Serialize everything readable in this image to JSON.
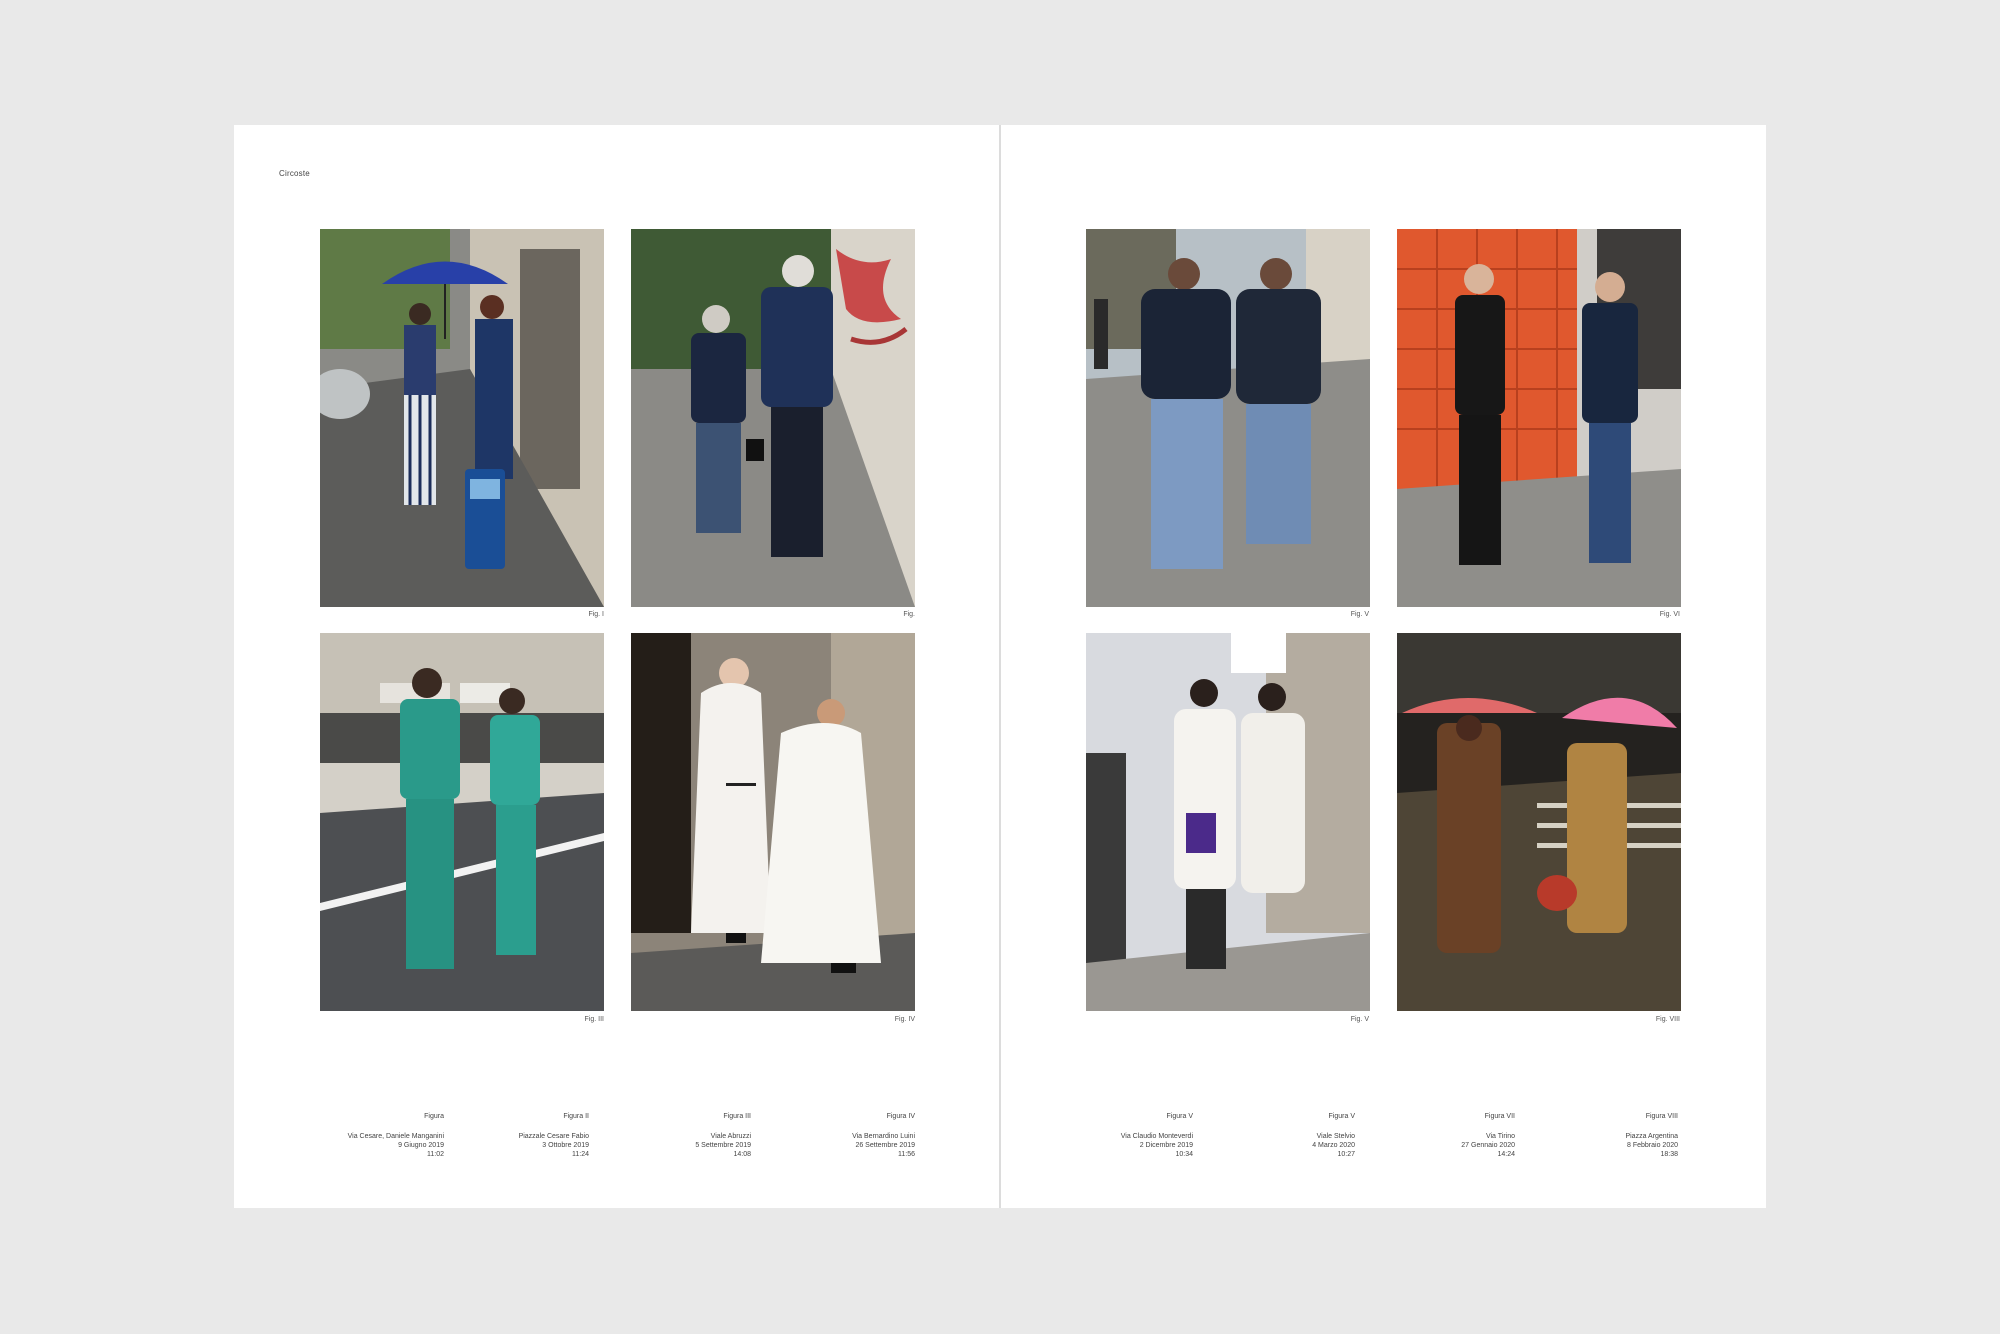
{
  "spread": {
    "running_head": "Circoste",
    "figures": [
      {
        "id": "I",
        "label": "Fig. I"
      },
      {
        "id": "II",
        "label": "Fig."
      },
      {
        "id": "III",
        "label": "Fig. III"
      },
      {
        "id": "IV",
        "label": "Fig. IV"
      },
      {
        "id": "V",
        "label": "Fig. V"
      },
      {
        "id": "VI",
        "label": "Fig. VI"
      },
      {
        "id": "VII",
        "label": "Fig. V"
      },
      {
        "id": "VIII",
        "label": "Fig. VIII"
      }
    ],
    "captions_left": [
      {
        "title": "Figura",
        "place": "Via Cesare, Daniele Manganini",
        "date": "9 Giugno 2019",
        "time": "11:02"
      },
      {
        "title": "Figura II",
        "place": "Piazzale Cesare Fabio",
        "date": "3 Ottobre 2019",
        "time": "11:24"
      },
      {
        "title": "Figura III",
        "place": "Viale Abruzzi",
        "date": "5 Settembre 2019",
        "time": "14:08"
      },
      {
        "title": "Figura IV",
        "place": "Via Bernardino Luini",
        "date": "26 Settembre 2019",
        "time": "11:56"
      }
    ],
    "captions_right": [
      {
        "title": "Figura V",
        "place": "Via Claudio Monteverdi",
        "date": "2 Dicembre 2019",
        "time": "10:34"
      },
      {
        "title": "Figura V",
        "place": "Viale Stelvio",
        "date": "4 Marzo 2020",
        "time": "10:27"
      },
      {
        "title": "Figura VII",
        "place": "Via Tirino",
        "date": "27 Gennaio 2020",
        "time": "14:24"
      },
      {
        "title": "Figura VIII",
        "place": "Piazza Argentina",
        "date": "8 Febbraio 2020",
        "time": "18:38"
      }
    ]
  }
}
